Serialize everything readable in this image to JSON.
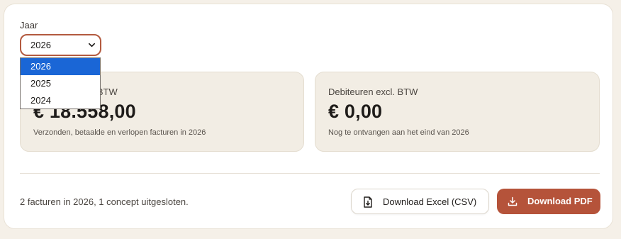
{
  "filter": {
    "label": "Jaar",
    "selected": "2026",
    "options": [
      "2026",
      "2025",
      "2024"
    ]
  },
  "cards": [
    {
      "title": "Omzet excl. BTW",
      "title_visible": "ecl. BTW",
      "value": "€ 18.558,00",
      "subtitle": "Verzonden, betaalde en verlopen facturen in 2026"
    },
    {
      "title": "Debiteuren excl. BTW",
      "value": "€ 0,00",
      "subtitle": "Nog te ontvangen aan het eind van 2026"
    }
  ],
  "summary": "2 facturen in 2026, 1 concept uitgesloten.",
  "actions": {
    "csv_label": "Download Excel (CSV)",
    "csv_icon": "file-download-icon",
    "pdf_label": "Download PDF",
    "pdf_icon": "download-icon"
  },
  "colors": {
    "accent": "#b5533a",
    "select_border": "#b35a3f",
    "dropdown_highlight": "#1a66d6",
    "card_bg": "#f2ede4",
    "page_bg": "#f5f0e8"
  }
}
